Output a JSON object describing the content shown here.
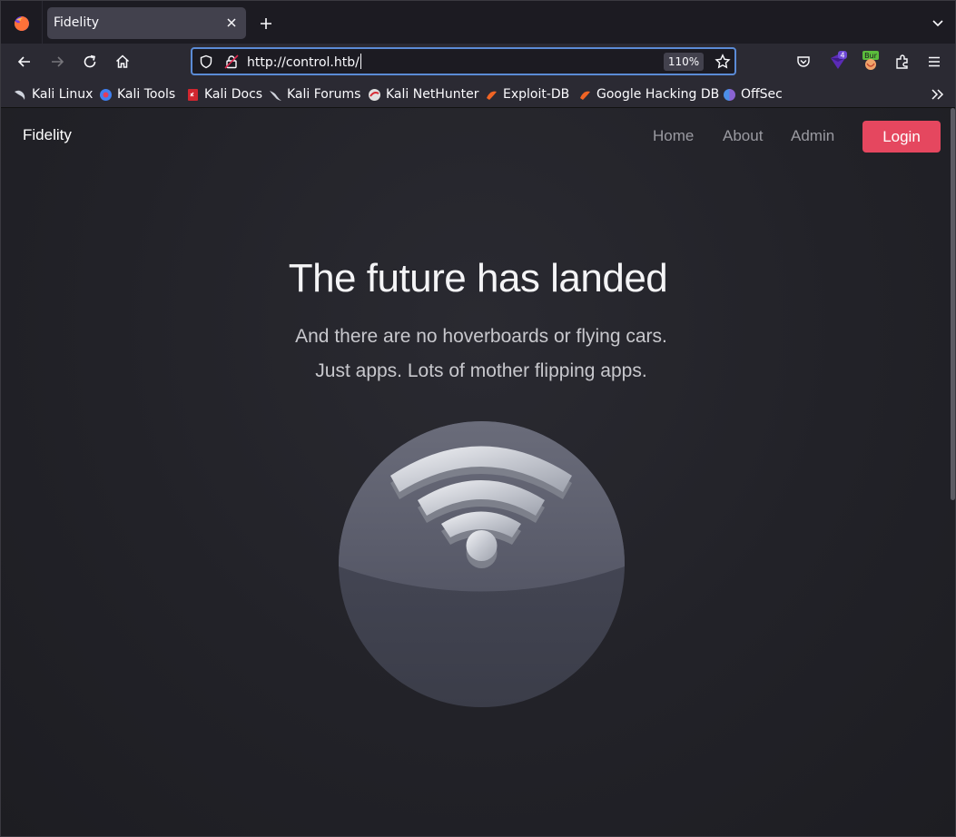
{
  "browser": {
    "tab_title": "Fidelity",
    "url": "http://control.htb/",
    "zoom": "110%",
    "extension_badge": "4",
    "bookmarks": [
      {
        "label": "Kali Linux",
        "icon": "kali-dragon-icon"
      },
      {
        "label": "Kali Tools",
        "icon": "kali-tools-icon"
      },
      {
        "label": "Kali Docs",
        "icon": "kali-docs-icon"
      },
      {
        "label": "Kali Forums",
        "icon": "kali-dragon-icon"
      },
      {
        "label": "Kali NetHunter",
        "icon": "nethunter-icon"
      },
      {
        "label": "Exploit-DB",
        "icon": "exploit-db-icon"
      },
      {
        "label": "Google Hacking DB",
        "icon": "exploit-db-icon"
      },
      {
        "label": "OffSec",
        "icon": "offsec-icon"
      }
    ]
  },
  "site": {
    "brand": "Fidelity",
    "nav": {
      "home": "Home",
      "about": "About",
      "admin": "Admin",
      "login": "Login"
    },
    "hero": {
      "title": "The future has landed",
      "line1": "And there are no hoverboards or flying cars.",
      "line2": "Just apps. Lots of mother flipping apps."
    },
    "accent_color": "#e5475f"
  }
}
